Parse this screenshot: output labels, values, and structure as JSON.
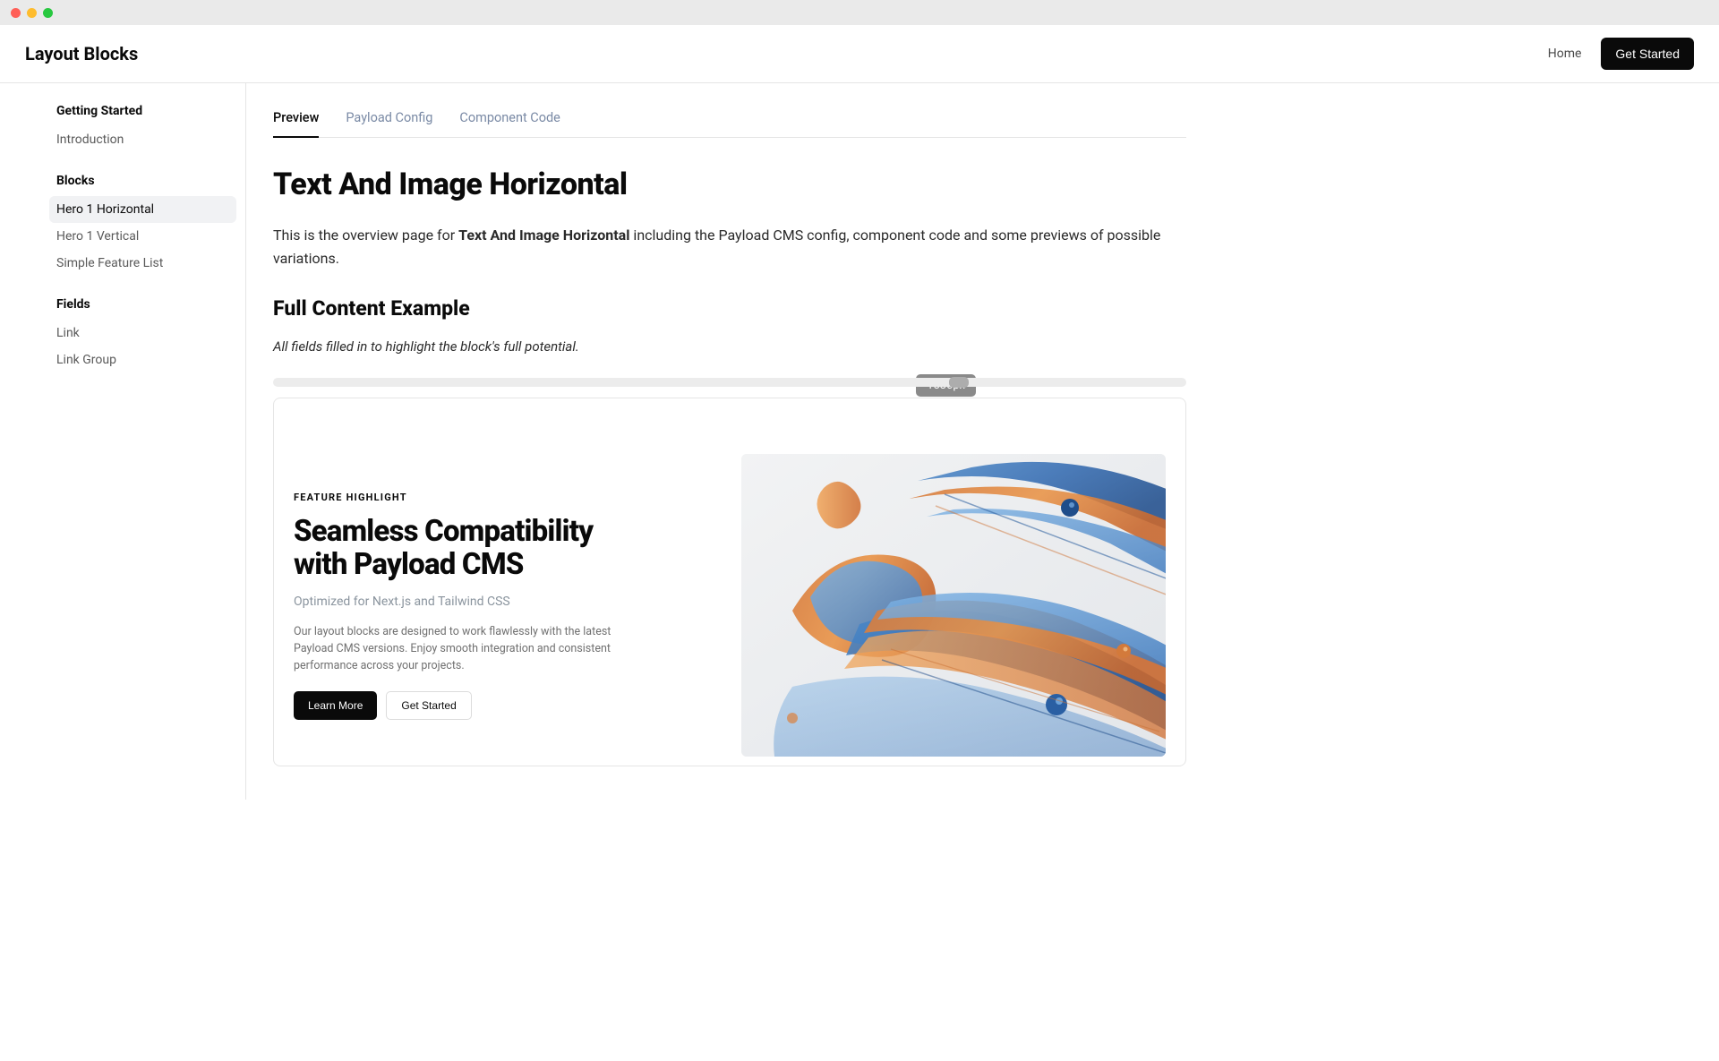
{
  "header": {
    "brand": "Layout Blocks",
    "nav_home": "Home",
    "cta": "Get Started"
  },
  "sidebar": {
    "sections": [
      {
        "heading": "Getting Started",
        "items": [
          {
            "label": "Introduction",
            "active": false
          }
        ]
      },
      {
        "heading": "Blocks",
        "items": [
          {
            "label": "Hero 1 Horizontal",
            "active": true
          },
          {
            "label": "Hero 1 Vertical",
            "active": false
          },
          {
            "label": "Simple Feature List",
            "active": false
          }
        ]
      },
      {
        "heading": "Fields",
        "items": [
          {
            "label": "Link",
            "active": false
          },
          {
            "label": "Link Group",
            "active": false
          }
        ]
      }
    ]
  },
  "tabs": [
    {
      "label": "Preview",
      "active": true
    },
    {
      "label": "Payload Config",
      "active": false
    },
    {
      "label": "Component Code",
      "active": false
    }
  ],
  "page": {
    "title": "Text And Image Horizontal",
    "intro_pre": "This is the overview page for ",
    "intro_bold": "Text And Image Horizontal",
    "intro_post": " including the Payload CMS config, component code and some previews of possible variations.",
    "section_heading": "Full Content Example",
    "subtitle": "All fields filled in to highlight the block's full potential.",
    "width_badge": "1536px"
  },
  "hero": {
    "eyebrow": "FEATURE HIGHLIGHT",
    "title": "Seamless Compatibility with Payload CMS",
    "subtitle": "Optimized for Next.js and Tailwind CSS",
    "body": "Our layout blocks are designed to work flawlessly with the latest Payload CMS versions. Enjoy smooth integration and consistent performance across your projects.",
    "primary_btn": "Learn More",
    "secondary_btn": "Get Started"
  }
}
